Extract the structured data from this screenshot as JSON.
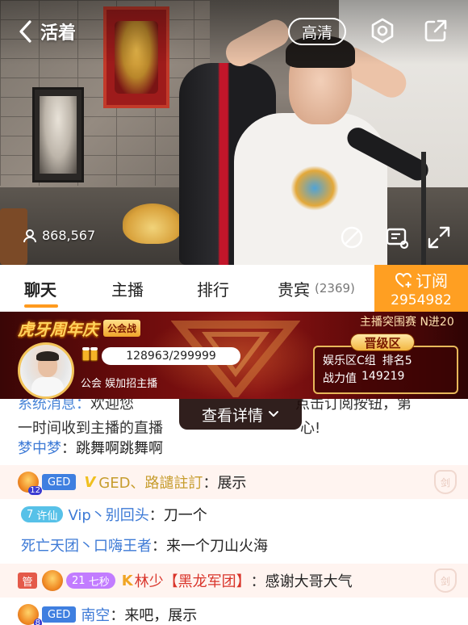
{
  "header": {
    "title": "活着",
    "quality_label": "高清"
  },
  "video": {
    "viewer_count": "868,567"
  },
  "tabs": [
    {
      "label": "聊天",
      "active": true
    },
    {
      "label": "主播"
    },
    {
      "label": "排行"
    },
    {
      "label": "贵宾",
      "count": "(2369)"
    }
  ],
  "subscribe": {
    "label": "订阅",
    "count": "2954982"
  },
  "event": {
    "title": "虎牙周年庆",
    "tag": "公会战",
    "right_title": "主播突围赛 N进20",
    "score": "128963/299999",
    "guild_label": "公会",
    "guild_name": "娱加招主播",
    "promo_badge": "晋级区",
    "promo_group": "娱乐区C组",
    "promo_rank": "排名5",
    "power_label": "战力值",
    "power_value": "149219"
  },
  "details_button": {
    "label": "查看详情"
  },
  "chat": {
    "system_prefix": "系统消息：",
    "system_text_1": "欢迎您",
    "system_tail_1": "点击订阅按钮，第",
    "system_text_2": "一时间收到主播的直播",
    "system_tail_2": "心!",
    "messages": [
      {
        "user": "梦中梦",
        "sep": "：",
        "text": "跳舞啊跳舞啊"
      },
      {
        "badge": "GED",
        "avatar_num": "12",
        "user": "GED、路譴註訂",
        "sep": "：",
        "text": "展示",
        "shield": "剑"
      },
      {
        "fan_level": "7",
        "fan_badge": "许仙",
        "user": "Vip丶别回头",
        "sep": "：",
        "text": "刀一个"
      },
      {
        "user": "死亡天团丶口嗨王者",
        "sep": "：",
        "text": "来一个刀山火海"
      },
      {
        "manage": "管",
        "level_num": "21",
        "level_name": "七秒",
        "user": "林少【黑龙军团】",
        "sep": "：",
        "text": "感谢大哥大气",
        "shield": "剑"
      },
      {
        "badge": "GED",
        "avatar_num": "8",
        "user": "南空",
        "sep": "：",
        "text": "来吧，展示"
      }
    ]
  }
}
